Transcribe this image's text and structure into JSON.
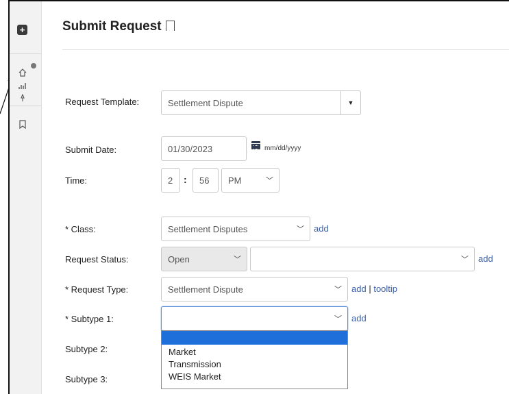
{
  "page": {
    "title": "Submit Request"
  },
  "sidebar": {
    "plus_label": "+"
  },
  "form": {
    "template": {
      "label": "Request Template:",
      "value": "Settlement Dispute"
    },
    "submit_date": {
      "label": "Submit Date:",
      "value": "01/30/2023",
      "hint": "mm/dd/yyyy"
    },
    "time": {
      "label": "Time:",
      "hour": "2",
      "minute": "56",
      "ampm": "PM"
    },
    "class": {
      "label": "* Class:",
      "value": "Settlement Disputes",
      "link": "add"
    },
    "status": {
      "label": "Request Status:",
      "value": "Open",
      "second_value": "",
      "link": "add"
    },
    "request_type": {
      "label": "* Request Type:",
      "value": "Settlement Dispute",
      "link_add": "add",
      "link_sep": "|",
      "link_tooltip": "tooltip"
    },
    "subtype1": {
      "label": "* Subtype 1:",
      "value": "",
      "link": "add",
      "options": [
        "",
        "Market",
        "Transmission",
        "WEIS Market"
      ]
    },
    "subtype2": {
      "label": "Subtype 2:"
    },
    "subtype3": {
      "label": "Subtype 3:"
    }
  },
  "icons": [
    "plus-icon",
    "home-icon",
    "bar-chart-icon",
    "pin-icon",
    "bookmark-icon",
    "calendar-icon",
    "chevron-down-icon"
  ]
}
